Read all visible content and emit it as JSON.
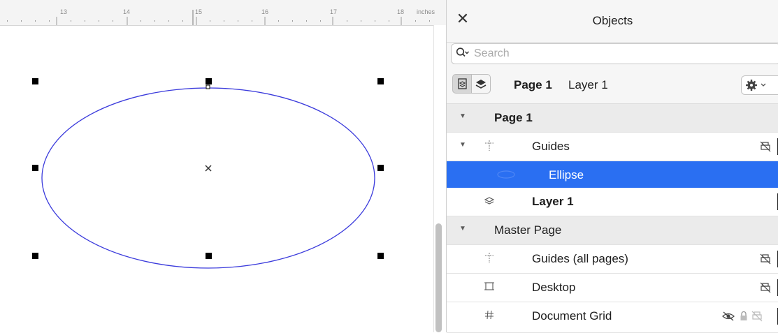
{
  "ruler": {
    "labels": [
      "13",
      "14",
      "15",
      "16",
      "17",
      "18"
    ],
    "units": "inches"
  },
  "objects_panel": {
    "title": "Objects",
    "close_icon": "close-icon",
    "search": {
      "placeholder": "Search",
      "value": ""
    },
    "toolbar": {
      "page": "Page 1",
      "layer": "Layer 1"
    },
    "tree": {
      "page1": "Page 1",
      "guides": "Guides",
      "ellipse": "Ellipse",
      "layer1": "Layer 1",
      "master_page": "Master Page",
      "guides_all": "Guides (all pages)",
      "desktop": "Desktop",
      "document_grid": "Document Grid"
    }
  },
  "colors": {
    "selection": "#2a6ff2",
    "ellipse_stroke": "#3b3bdc",
    "handle": "#000000"
  }
}
